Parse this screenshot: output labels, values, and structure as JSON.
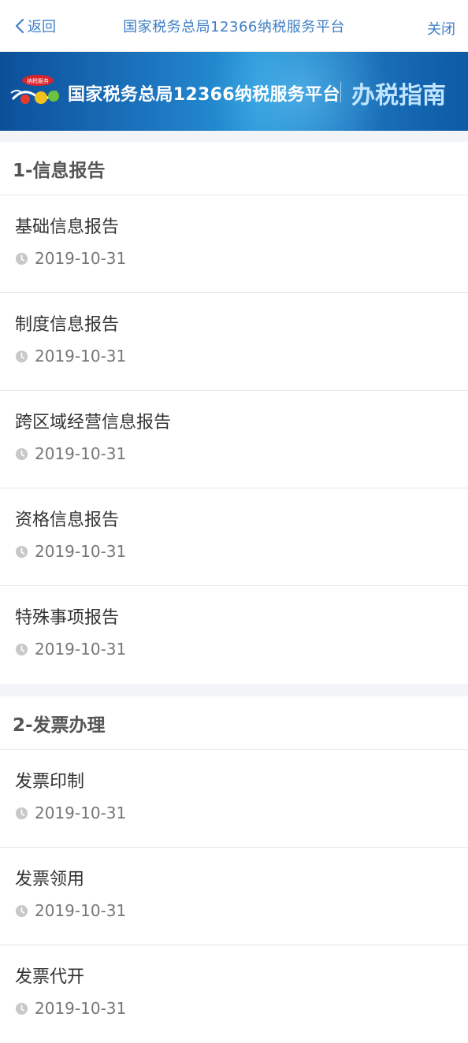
{
  "nav": {
    "back_label": "返回",
    "title": "国家税务总局12366纳税服务平台",
    "close_label": "关闭"
  },
  "banner": {
    "logo_text": "纳税服务",
    "title": "国家税务总局12366纳税服务平台",
    "subtitle": "办税指南"
  },
  "sections": [
    {
      "heading": "1-信息报告",
      "items": [
        {
          "title": "基础信息报告",
          "date": "2019-10-31"
        },
        {
          "title": "制度信息报告",
          "date": "2019-10-31"
        },
        {
          "title": "跨区域经营信息报告",
          "date": "2019-10-31"
        },
        {
          "title": "资格信息报告",
          "date": "2019-10-31"
        },
        {
          "title": "特殊事项报告",
          "date": "2019-10-31"
        }
      ]
    },
    {
      "heading": "2-发票办理",
      "items": [
        {
          "title": "发票印制",
          "date": "2019-10-31"
        },
        {
          "title": "发票领用",
          "date": "2019-10-31"
        },
        {
          "title": "发票代开",
          "date": "2019-10-31"
        }
      ]
    }
  ],
  "colors": {
    "accent": "#3f7fc6",
    "banner_dark": "#0c4f99",
    "banner_light": "#2596d7",
    "divider": "#e6e6e6",
    "section_gap": "#f2f4f7"
  },
  "icons": {
    "back": "chevron-left-icon",
    "date": "clock-icon",
    "logo": "12366-logo-icon"
  }
}
